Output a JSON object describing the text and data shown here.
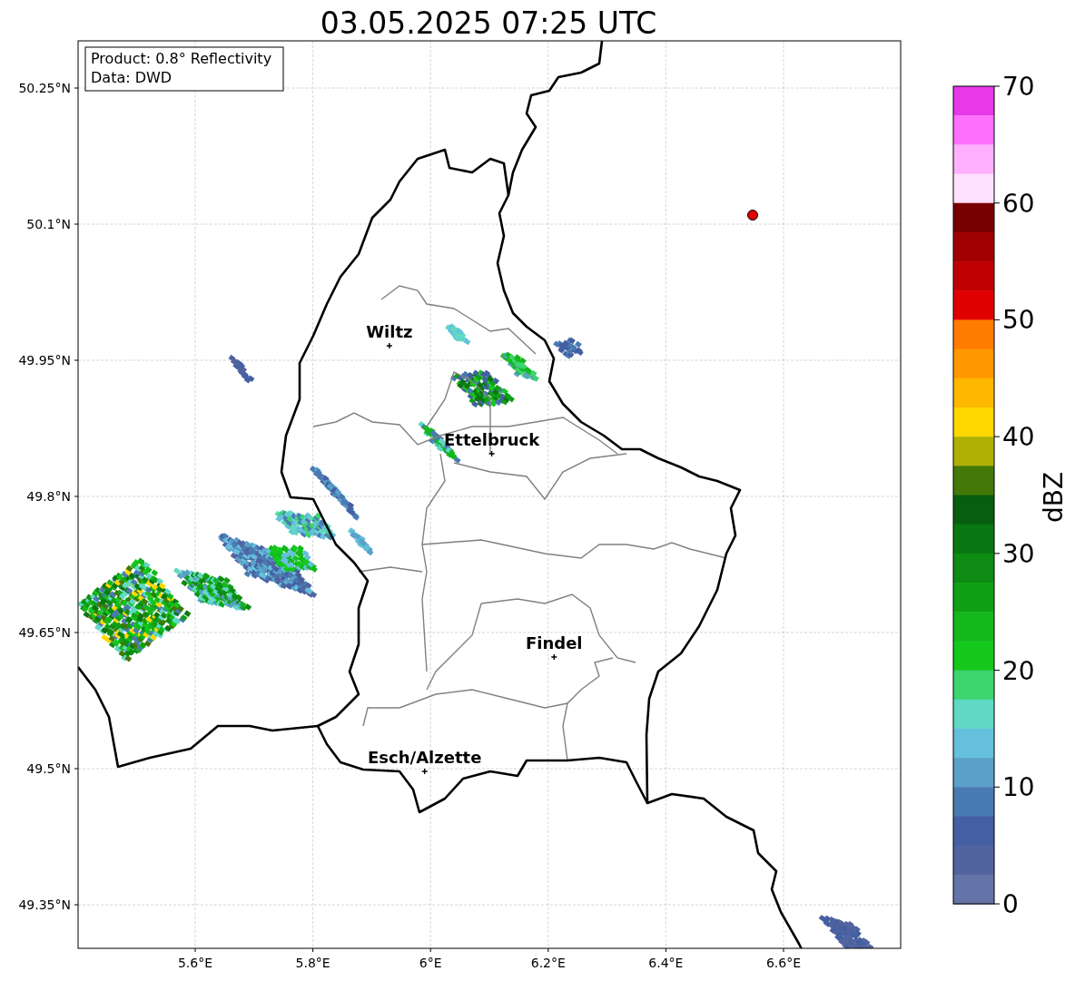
{
  "title": "03.05.2025 07:25 UTC",
  "info_box": [
    "Product: 0.8° Reflectivity",
    "Data: DWD"
  ],
  "map": {
    "x_ticks": [
      "5.6°E",
      "5.8°E",
      "6°E",
      "6.2°E",
      "6.4°E",
      "6.6°E"
    ],
    "y_ticks": [
      "50.25°N",
      "50.1°N",
      "49.95°N",
      "49.8°N",
      "49.65°N",
      "49.5°N",
      "49.35°N"
    ],
    "cities": [
      "Wiltz",
      "Ettelbruck",
      "Findel",
      "Esch/Alzette"
    ]
  },
  "colorbar": {
    "label": "dBZ",
    "ticks": [
      "70",
      "60",
      "50",
      "40",
      "30",
      "20",
      "10",
      "0"
    ],
    "bins": [
      {
        "color": "#e838e8"
      },
      {
        "color": "#ff70ff"
      },
      {
        "color": "#ffb0ff"
      },
      {
        "color": "#ffe0ff"
      },
      {
        "color": "#780000"
      },
      {
        "color": "#a00000"
      },
      {
        "color": "#c00000"
      },
      {
        "color": "#e00000"
      },
      {
        "color": "#ff7c00"
      },
      {
        "color": "#ff9800"
      },
      {
        "color": "#ffb800"
      },
      {
        "color": "#ffd800"
      },
      {
        "color": "#b0b004"
      },
      {
        "color": "#447808"
      },
      {
        "color": "#085e0e"
      },
      {
        "color": "#0a7812"
      },
      {
        "color": "#0e8c14"
      },
      {
        "color": "#10a014"
      },
      {
        "color": "#12b81c"
      },
      {
        "color": "#14c81c"
      },
      {
        "color": "#3cd46c"
      },
      {
        "color": "#60d8c4"
      },
      {
        "color": "#64c0dc"
      },
      {
        "color": "#5aa0c8"
      },
      {
        "color": "#4a7ab2"
      },
      {
        "color": "#4460a2"
      },
      {
        "color": "#5264a0"
      },
      {
        "color": "#6474a8"
      }
    ]
  }
}
